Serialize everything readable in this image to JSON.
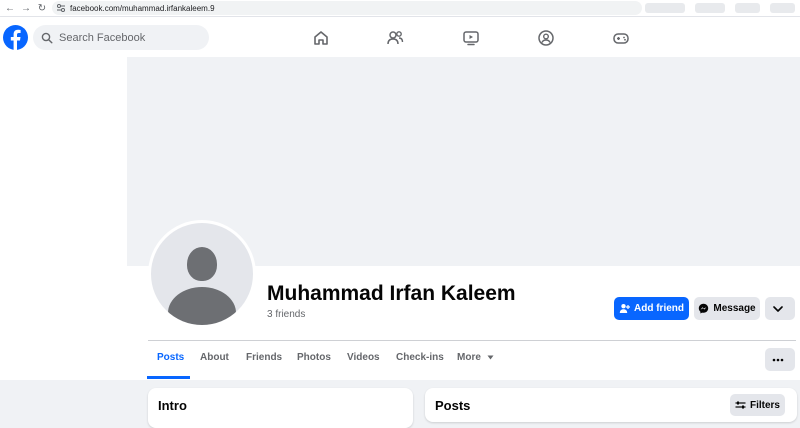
{
  "browser": {
    "url": "facebook.com/muhammad.irfankaleem.9"
  },
  "header": {
    "search_placeholder": "Search Facebook",
    "nav_icons": [
      "home-icon",
      "friends-icon",
      "watch-icon",
      "groups-icon",
      "gaming-icon"
    ]
  },
  "profile": {
    "name": "Muhammad Irfan Kaleem",
    "friends_count": "3 friends",
    "add_friend_label": "Add friend",
    "message_label": "Message"
  },
  "tabs": [
    {
      "label": "Posts",
      "active": true
    },
    {
      "label": "About",
      "active": false
    },
    {
      "label": "Friends",
      "active": false
    },
    {
      "label": "Photos",
      "active": false
    },
    {
      "label": "Videos",
      "active": false
    },
    {
      "label": "Check-ins",
      "active": false
    },
    {
      "label": "More",
      "active": false
    }
  ],
  "cards": {
    "intro_title": "Intro",
    "posts_title": "Posts",
    "filters_label": "Filters"
  },
  "colors": {
    "brand": "#0866ff",
    "secondary_button": "#e4e6eb",
    "page_bg": "#f0f2f5"
  }
}
